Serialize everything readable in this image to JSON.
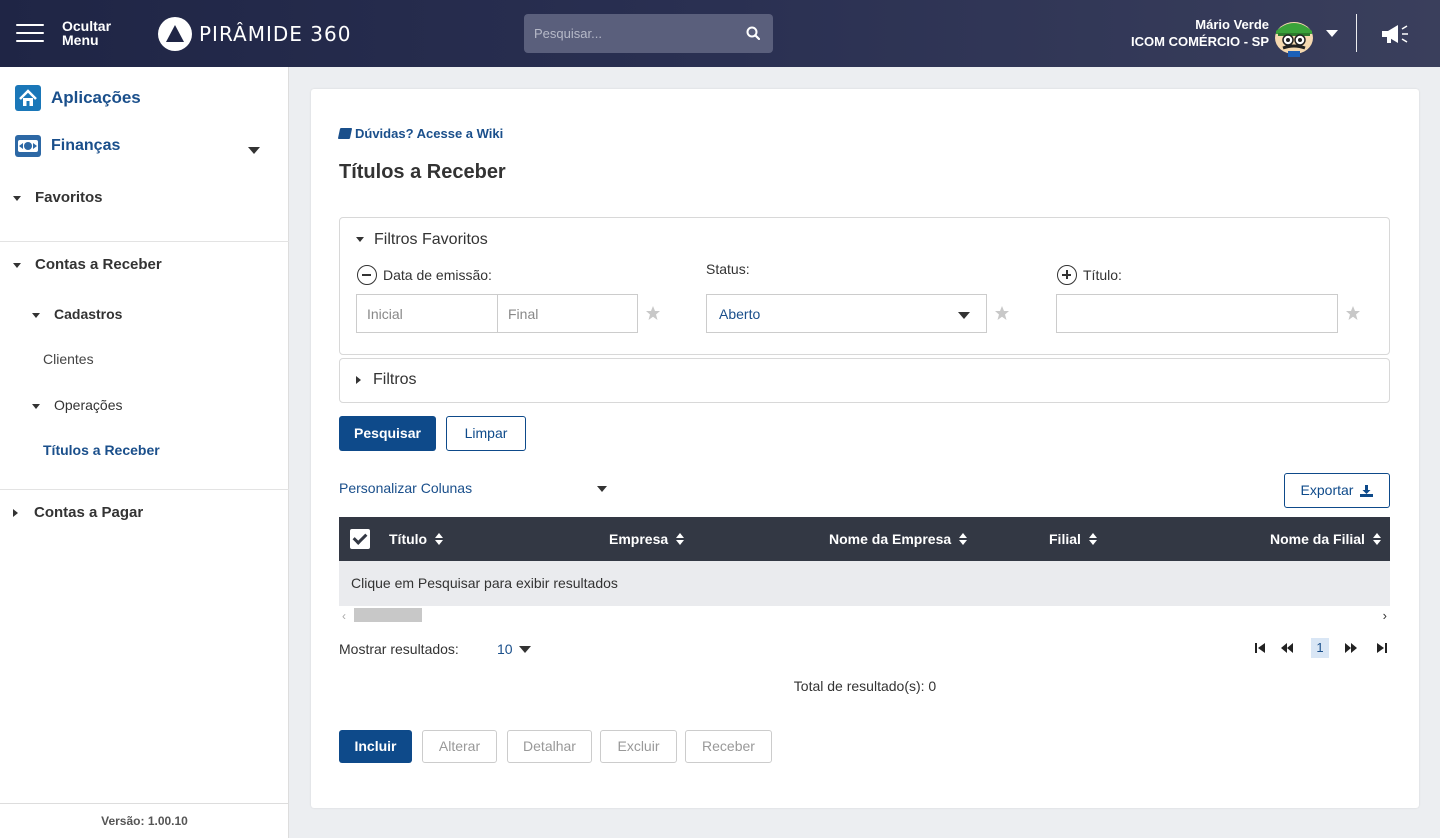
{
  "header": {
    "hide_menu_line1": "Ocultar",
    "hide_menu_line2": "Menu",
    "brand": "PIRÂMIDE 360",
    "search_placeholder": "Pesquisar...",
    "user_name": "Mário Verde",
    "company": "ICOM COMÉRCIO - SP"
  },
  "sidebar": {
    "applications": "Aplicações",
    "finance": "Finanças",
    "favorites": "Favoritos",
    "receivables": "Contas a Receber",
    "registers": "Cadastros",
    "clients": "Clientes",
    "operations": "Operações",
    "titles": "Títulos a Receber",
    "payables": "Contas a Pagar",
    "version": "Versão: 1.00.10"
  },
  "main": {
    "wiki": "Dúvidas? Acesse a Wiki",
    "title": "Títulos a Receber",
    "fav_filters": "Filtros Favoritos",
    "emission_label": "Data de emissão:",
    "initial_placeholder": "Inicial",
    "final_placeholder": "Final",
    "status_label": "Status:",
    "status_value": "Aberto",
    "title_label": "Título:",
    "filters": "Filtros",
    "search_btn": "Pesquisar",
    "clear_btn": "Limpar",
    "customize_columns": "Personalizar Colunas",
    "export_btn": "Exportar",
    "columns": [
      "Título",
      "Empresa",
      "Nome da Empresa",
      "Filial",
      "Nome da Filial"
    ],
    "empty_msg": "Clique em Pesquisar para exibir resultados",
    "show_results": "Mostrar resultados:",
    "page_size": "10",
    "current_page": "1",
    "total": "Total de resultado(s): 0",
    "actions": {
      "include": "Incluir",
      "alter": "Alterar",
      "detail": "Detalhar",
      "delete": "Excluir",
      "receive": "Receber"
    }
  },
  "colors": {
    "header_bg": "#1f2545",
    "primary": "#0e4a8a",
    "link": "#1a4f8b",
    "table_header": "#333844"
  }
}
